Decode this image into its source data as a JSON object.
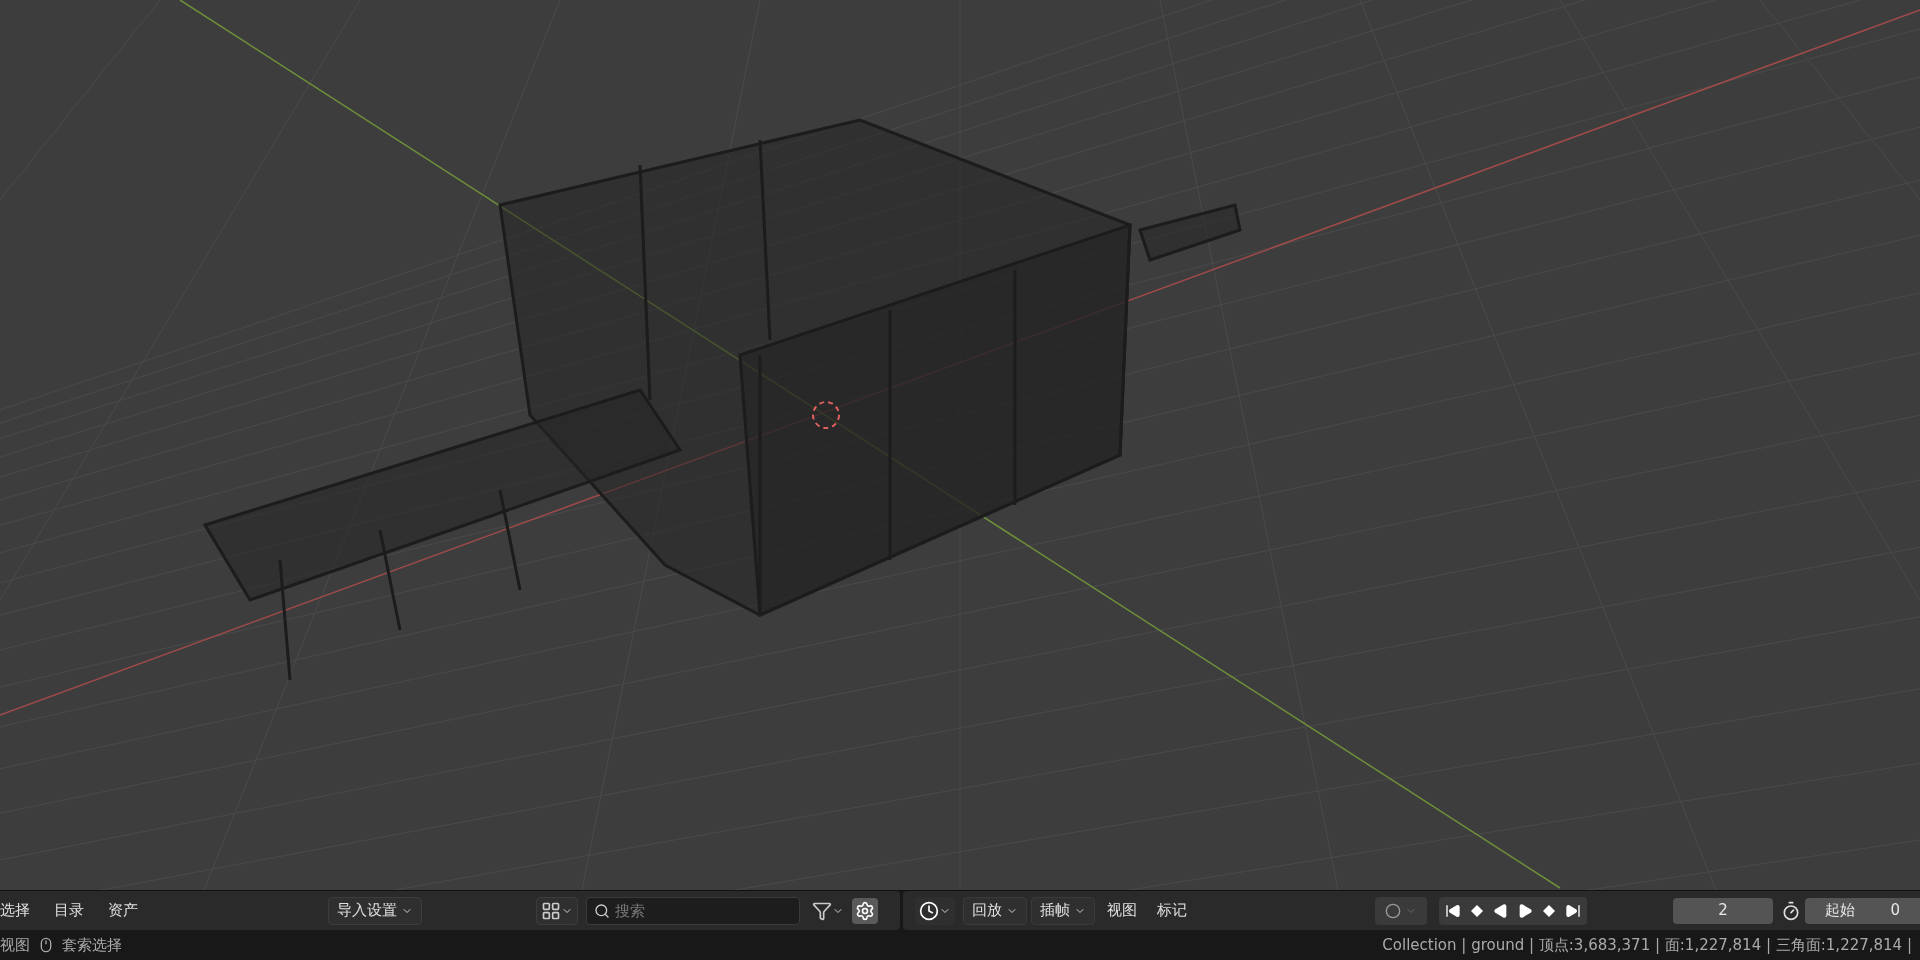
{
  "file_browser_header": {
    "menus": [
      "选择",
      "目录",
      "资产"
    ],
    "import_settings": "导入设置",
    "search": {
      "placeholder": "搜索"
    },
    "settings_active": true
  },
  "timeline_header": {
    "menus": [
      {
        "label": "回放",
        "dropdown": true
      },
      {
        "label": "插帧",
        "dropdown": true
      },
      {
        "label": "视图",
        "dropdown": false
      },
      {
        "label": "标记",
        "dropdown": false
      }
    ],
    "auto_keying": false,
    "current_frame": "2",
    "start": {
      "label": "起始",
      "value": "0"
    }
  },
  "status_bar": {
    "left": [
      "视图",
      "套索选择"
    ],
    "right": "Collection | ground | 顶点:3,683,371 | 面:1,227,814 | 三角面:1,227,814 |"
  }
}
